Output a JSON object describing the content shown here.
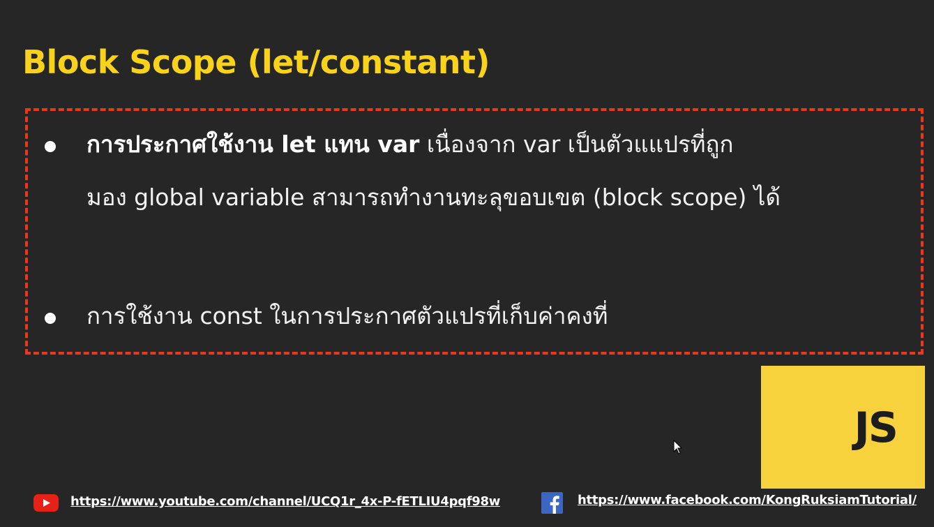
{
  "slide": {
    "title": "Block Scope (let/constant)",
    "bullets": [
      {
        "bold": "การประกาศใช้งาน let แทน var",
        "line1_rest": " เนื่องจาก var เป็นตัวแแปรที่ถูก",
        "line2": "มอง global variable สามารถทำงานทะลุขอบเขต (block scope) ได้"
      },
      {
        "text": "การใช้งาน const ในการประกาศตัวแปรที่เก็บค่าคงที่"
      }
    ]
  },
  "logo": {
    "text": "JS",
    "background": "#f7d23d"
  },
  "footer": {
    "youtube_icon": "youtube-icon",
    "youtube_url": "https://www.youtube.com/channel/UCQ1r_4x-P-fETLIU4pqf98w",
    "facebook_icon": "facebook-icon",
    "facebook_url": "https://www.facebook.com/KongRuksiamTutorial/"
  },
  "colors": {
    "background": "#262626",
    "title": "#f8d21b",
    "box_border": "#e8391f",
    "youtube": "#e62117",
    "facebook": "#3b66c4"
  }
}
